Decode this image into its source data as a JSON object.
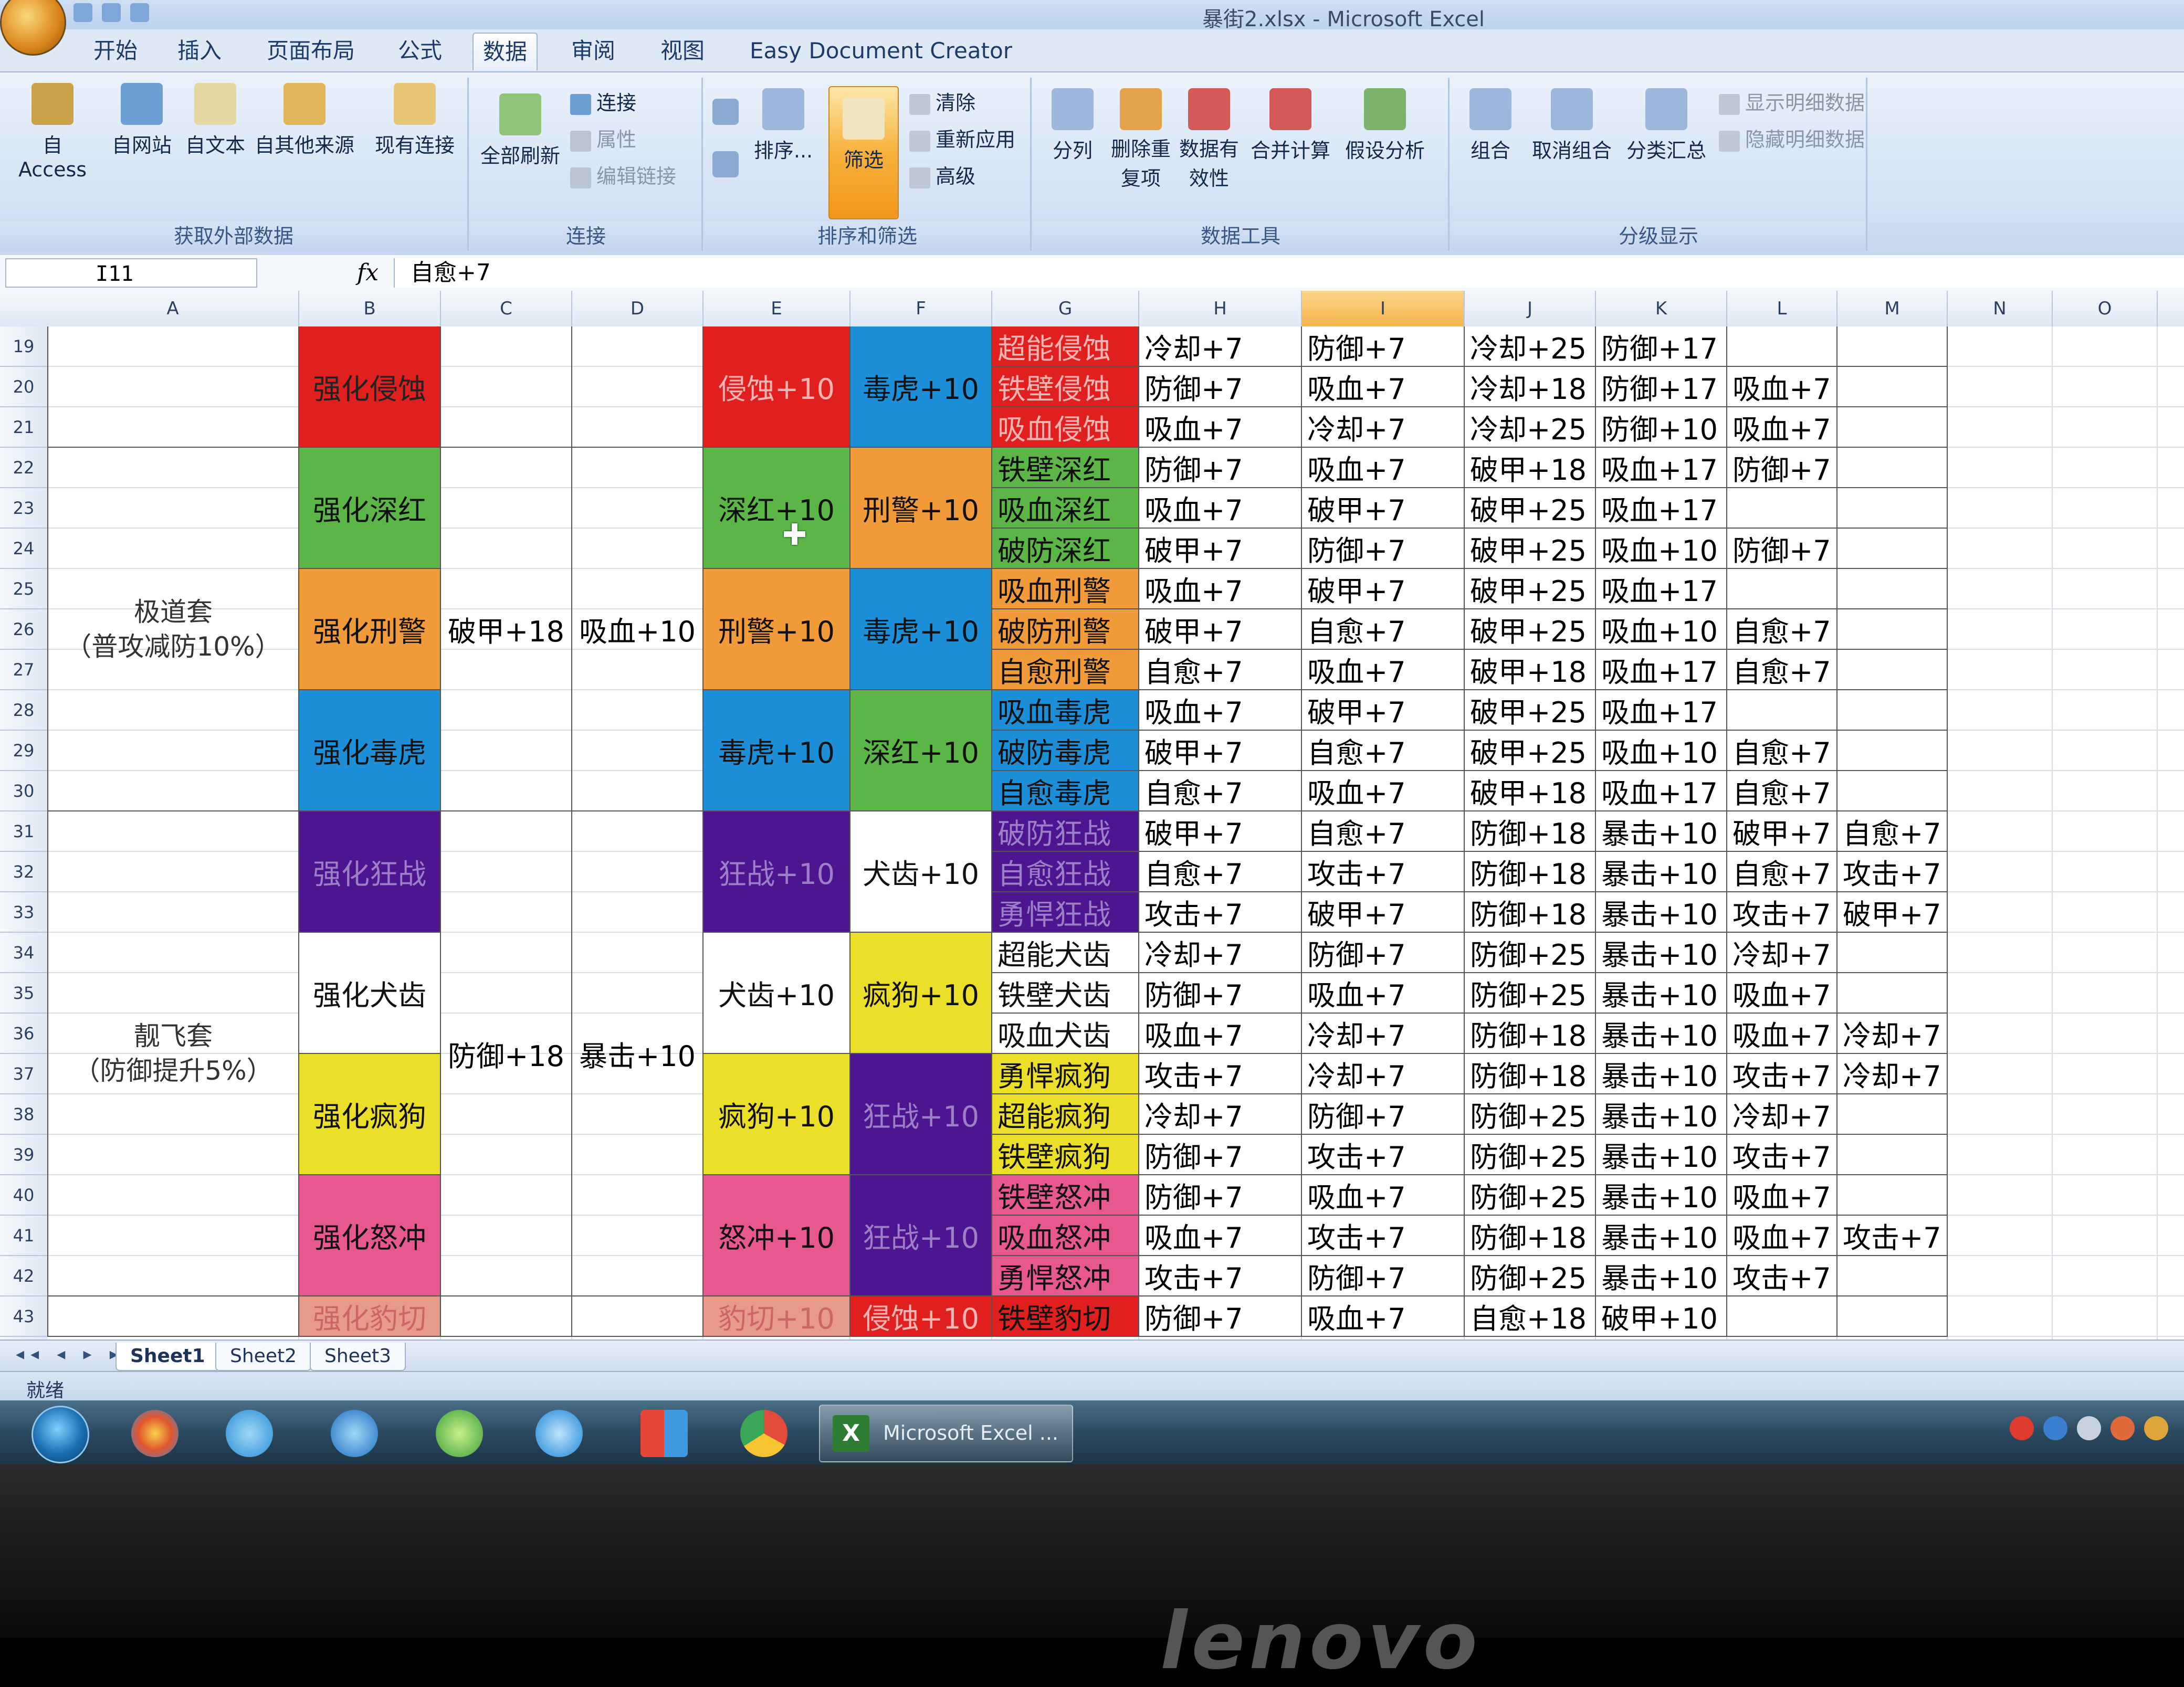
{
  "window": {
    "title": "暴街2.xlsx - Microsoft Excel"
  },
  "tabs": [
    "开始",
    "插入",
    "页面布局",
    "公式",
    "数据",
    "审阅",
    "视图",
    "Easy Document Creator"
  ],
  "active_tab": "数据",
  "ribbon": {
    "get_external": {
      "label": "获取外部数据",
      "buttons": [
        "自 Access",
        "自网站",
        "自文本",
        "自其他来源",
        "现有连接"
      ]
    },
    "connections": {
      "label": "连接",
      "refresh_all": "全部刷新",
      "small": [
        "连接",
        "属性",
        "编辑链接"
      ]
    },
    "sort_filter": {
      "label": "排序和筛选",
      "sort": "排序...",
      "filter": "筛选",
      "small": [
        "清除",
        "重新应用",
        "高级"
      ]
    },
    "data_tools": {
      "label": "数据工具",
      "buttons": [
        "分列",
        "删除重复项",
        "数据有效性",
        "合并计算",
        "假设分析"
      ]
    },
    "outline": {
      "label": "分级显示",
      "buttons": [
        "组合",
        "取消组合",
        "分类汇总"
      ],
      "small": [
        "显示明细数据",
        "隐藏明细数据"
      ]
    }
  },
  "formula_bar": {
    "name_box": "I11",
    "fx": "fx",
    "formula": "自愈+7"
  },
  "columns": [
    "A",
    "B",
    "C",
    "D",
    "E",
    "F",
    "G",
    "H",
    "I",
    "J",
    "K",
    "L",
    "M",
    "N",
    "O"
  ],
  "selected_column": "I",
  "rows": [
    19,
    20,
    21,
    22,
    23,
    24,
    25,
    26,
    27,
    28,
    29,
    30,
    31,
    32,
    33,
    34,
    35,
    36,
    37,
    38,
    39,
    40,
    41,
    42,
    43
  ],
  "sets": [
    {
      "name": "极道套",
      "desc": "（普攻减防10%）",
      "c": "破甲+18",
      "d": "吸血+10"
    },
    {
      "name": "靓飞套",
      "desc": "（防御提升5%）",
      "c": "防御+18",
      "d": "暴击+10"
    }
  ],
  "groups": [
    {
      "b": "强化侵蚀",
      "e": "侵蚀+10",
      "f": "毒虎+10"
    },
    {
      "b": "强化深红",
      "e": "深红+10",
      "f": "刑警+10"
    },
    {
      "b": "强化刑警",
      "e": "刑警+10",
      "f": "毒虎+10"
    },
    {
      "b": "强化毒虎",
      "e": "毒虎+10",
      "f": "深红+10"
    },
    {
      "b": "强化狂战",
      "e": "狂战+10",
      "f": "犬齿+10"
    },
    {
      "b": "强化犬齿",
      "e": "犬齿+10",
      "f": "疯狗+10"
    },
    {
      "b": "强化疯狗",
      "e": "疯狗+10",
      "f": "狂战+10"
    },
    {
      "b": "强化怒冲",
      "e": "怒冲+10",
      "f": "狂战+10"
    },
    {
      "b": "强化豹切",
      "e": "豹切+10",
      "f": "侵蚀+10"
    }
  ],
  "detail_rows": [
    [
      "超能侵蚀",
      "冷却+7",
      "防御+7",
      "冷却+25",
      "防御+17",
      "",
      ""
    ],
    [
      "铁壁侵蚀",
      "防御+7",
      "吸血+7",
      "冷却+18",
      "防御+17",
      "吸血+7",
      ""
    ],
    [
      "吸血侵蚀",
      "吸血+7",
      "冷却+7",
      "冷却+25",
      "防御+10",
      "吸血+7",
      ""
    ],
    [
      "铁壁深红",
      "防御+7",
      "吸血+7",
      "破甲+18",
      "吸血+17",
      "防御+7",
      ""
    ],
    [
      "吸血深红",
      "吸血+7",
      "破甲+7",
      "破甲+25",
      "吸血+17",
      "",
      ""
    ],
    [
      "破防深红",
      "破甲+7",
      "防御+7",
      "破甲+25",
      "吸血+10",
      "防御+7",
      ""
    ],
    [
      "吸血刑警",
      "吸血+7",
      "破甲+7",
      "破甲+25",
      "吸血+17",
      "",
      ""
    ],
    [
      "破防刑警",
      "破甲+7",
      "自愈+7",
      "破甲+25",
      "吸血+10",
      "自愈+7",
      ""
    ],
    [
      "自愈刑警",
      "自愈+7",
      "吸血+7",
      "破甲+18",
      "吸血+17",
      "自愈+7",
      ""
    ],
    [
      "吸血毒虎",
      "吸血+7",
      "破甲+7",
      "破甲+25",
      "吸血+17",
      "",
      ""
    ],
    [
      "破防毒虎",
      "破甲+7",
      "自愈+7",
      "破甲+25",
      "吸血+10",
      "自愈+7",
      ""
    ],
    [
      "自愈毒虎",
      "自愈+7",
      "吸血+7",
      "破甲+18",
      "吸血+17",
      "自愈+7",
      ""
    ],
    [
      "破防狂战",
      "破甲+7",
      "自愈+7",
      "防御+18",
      "暴击+10",
      "破甲+7",
      "自愈+7"
    ],
    [
      "自愈狂战",
      "自愈+7",
      "攻击+7",
      "防御+18",
      "暴击+10",
      "自愈+7",
      "攻击+7"
    ],
    [
      "勇悍狂战",
      "攻击+7",
      "破甲+7",
      "防御+18",
      "暴击+10",
      "攻击+7",
      "破甲+7"
    ],
    [
      "超能犬齿",
      "冷却+7",
      "防御+7",
      "防御+25",
      "暴击+10",
      "冷却+7",
      ""
    ],
    [
      "铁壁犬齿",
      "防御+7",
      "吸血+7",
      "防御+25",
      "暴击+10",
      "吸血+7",
      ""
    ],
    [
      "吸血犬齿",
      "吸血+7",
      "冷却+7",
      "防御+18",
      "暴击+10",
      "吸血+7",
      "冷却+7"
    ],
    [
      "勇悍疯狗",
      "攻击+7",
      "冷却+7",
      "防御+18",
      "暴击+10",
      "攻击+7",
      "冷却+7"
    ],
    [
      "超能疯狗",
      "冷却+7",
      "防御+7",
      "防御+25",
      "暴击+10",
      "冷却+7",
      ""
    ],
    [
      "铁壁疯狗",
      "防御+7",
      "攻击+7",
      "防御+25",
      "暴击+10",
      "攻击+7",
      ""
    ],
    [
      "铁壁怒冲",
      "防御+7",
      "吸血+7",
      "防御+25",
      "暴击+10",
      "吸血+7",
      ""
    ],
    [
      "吸血怒冲",
      "吸血+7",
      "攻击+7",
      "防御+18",
      "暴击+10",
      "吸血+7",
      "攻击+7"
    ],
    [
      "勇悍怒冲",
      "攻击+7",
      "防御+7",
      "防御+25",
      "暴击+10",
      "攻击+7",
      ""
    ],
    [
      "铁壁豹切",
      "防御+7",
      "吸血+7",
      "自愈+18",
      "破甲+10",
      "",
      ""
    ]
  ],
  "colors": {
    "red": "#e0201f",
    "green": "#5bb647",
    "orange": "#f19a3a",
    "blue": "#1c8fd8",
    "purple": "#4d1590",
    "white": "#ffffff",
    "yellow": "#ecdf2a",
    "pink": "#e85890",
    "salmon": "#e89a8a"
  },
  "sheets": [
    "Sheet1",
    "Sheet2",
    "Sheet3"
  ],
  "status": "就绪",
  "taskbar": {
    "app": "Microsoft Excel ..."
  },
  "bezel_brand": "lenovo"
}
